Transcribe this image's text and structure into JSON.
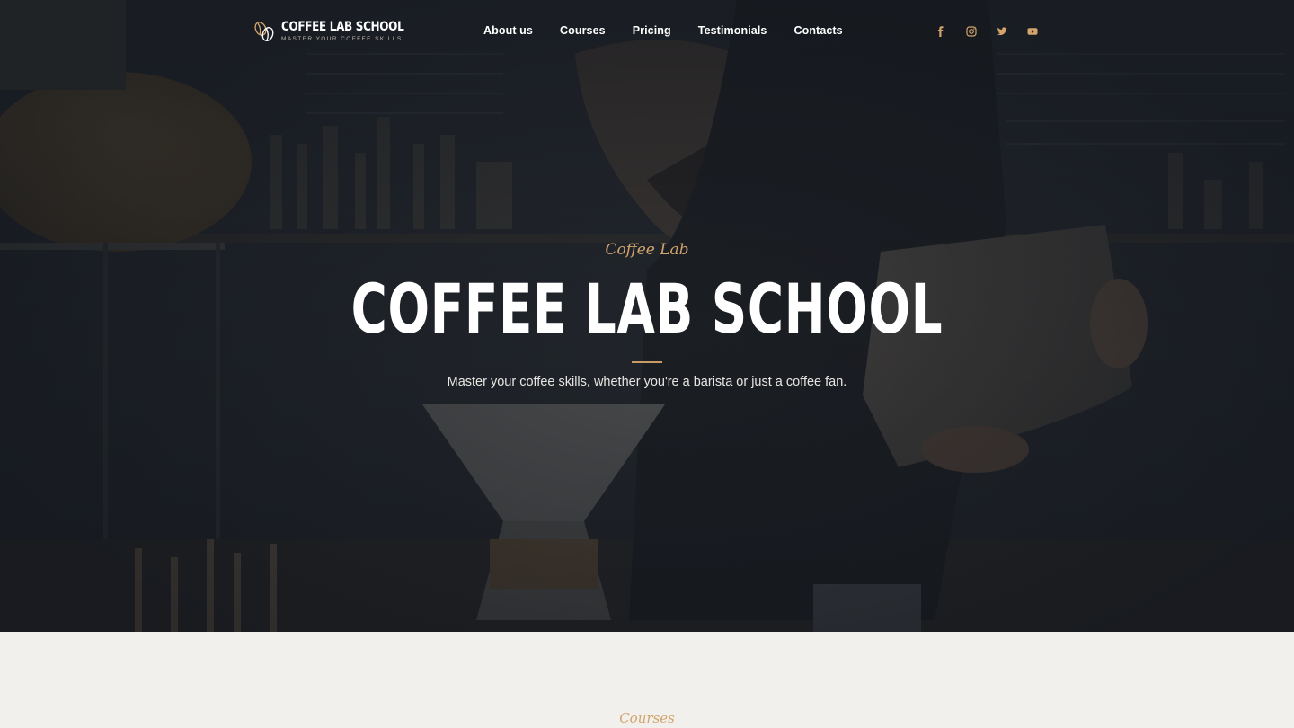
{
  "brand": {
    "title": "COFFEE LAB SCHOOL",
    "tagline": "MASTER YOUR COFFEE SKILLS"
  },
  "nav": {
    "items": [
      {
        "label": "About us"
      },
      {
        "label": "Courses"
      },
      {
        "label": "Pricing"
      },
      {
        "label": "Testimonials"
      },
      {
        "label": "Contacts"
      }
    ]
  },
  "social": [
    "facebook-icon",
    "instagram-icon",
    "twitter-icon",
    "youtube-icon"
  ],
  "hero": {
    "eyebrow": "Coffee Lab",
    "title": "COFFEE LAB SCHOOL",
    "subtitle": "Master your coffee skills, whether you're a barista or just a coffee fan."
  },
  "courses_section": {
    "eyebrow": "Courses"
  },
  "colors": {
    "accent": "#c99a63",
    "background": "#f1f0ec",
    "hero_dark": "#262a30"
  }
}
